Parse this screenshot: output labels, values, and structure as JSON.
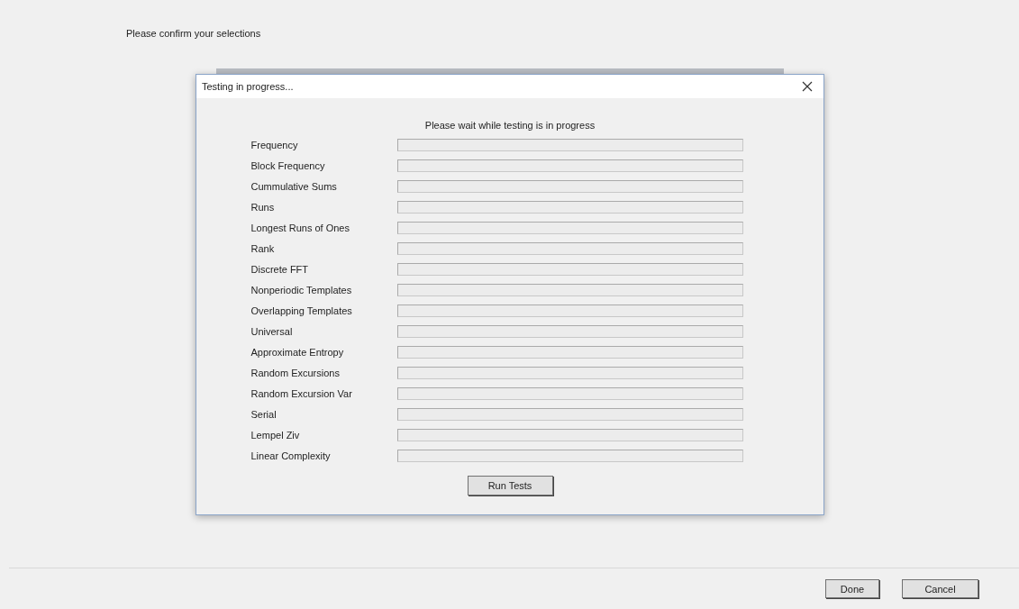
{
  "prompt": "Please confirm your selections",
  "dialog": {
    "title": "Testing in progress...",
    "message": "Please wait while testing is in progress",
    "tests": [
      {
        "name": "Frequency",
        "level": 0
      },
      {
        "name": "Block Frequency",
        "level": 0
      },
      {
        "name": "Cummulative Sums",
        "level": 0
      },
      {
        "name": "Runs",
        "level": 0
      },
      {
        "name": "Longest Runs of Ones",
        "level": 0
      },
      {
        "name": "Rank",
        "level": 0
      },
      {
        "name": "Discrete FFT",
        "level": 0
      },
      {
        "name": "Nonperiodic Templates",
        "level": 0
      },
      {
        "name": "Overlapping Templates",
        "level": 0
      },
      {
        "name": "Universal",
        "level": 0
      },
      {
        "name": "Approximate Entropy",
        "level": 0
      },
      {
        "name": "Random Excursions",
        "level": 0
      },
      {
        "name": "Random Excursion Var",
        "level": 0
      },
      {
        "name": "Serial",
        "level": 0
      },
      {
        "name": "Lempel Ziv",
        "level": 0
      },
      {
        "name": "Linear Complexity",
        "level": 0
      }
    ],
    "button": "Run Tests"
  },
  "buttons": [
    "Done",
    "Cancel"
  ]
}
